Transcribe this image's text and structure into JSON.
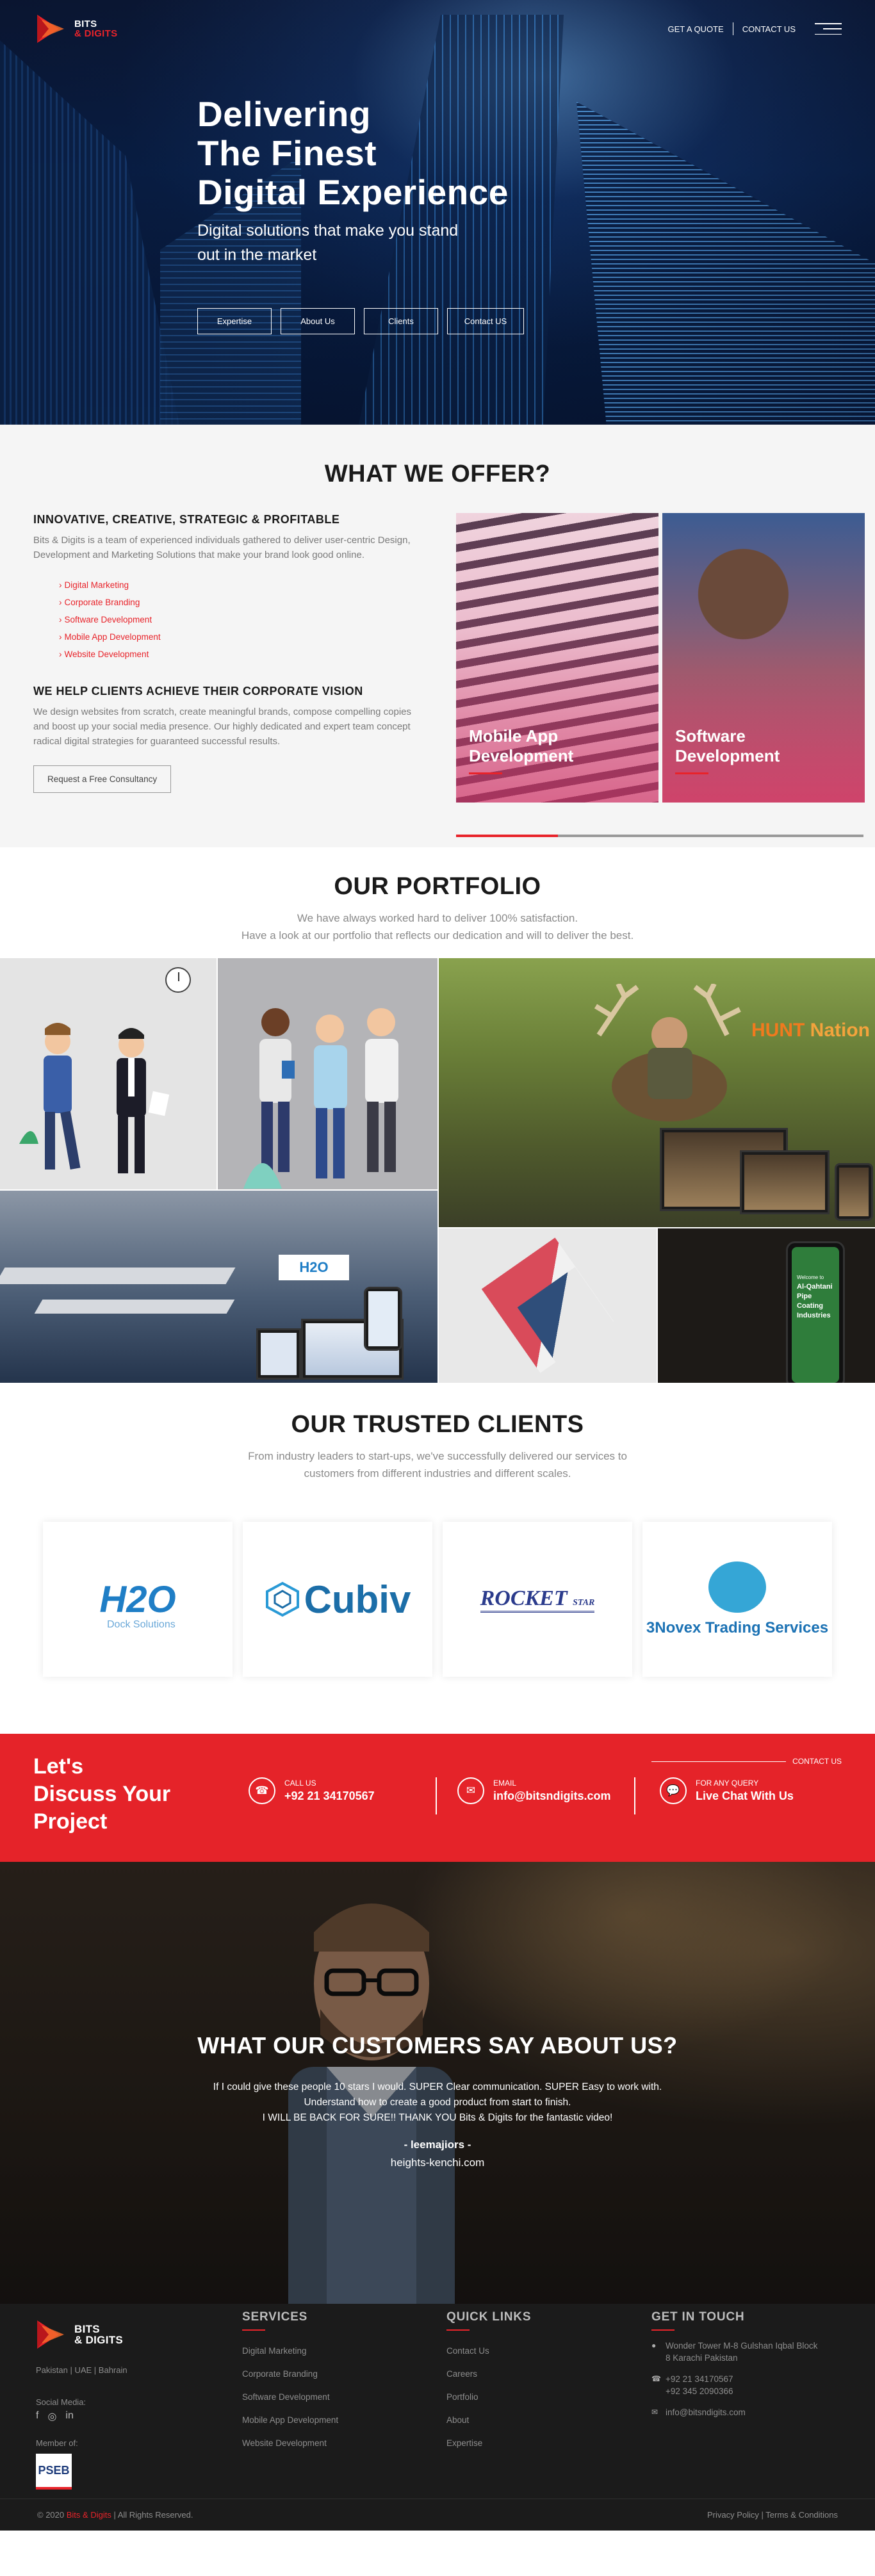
{
  "brand": {
    "name_line1": "BITS",
    "name_line2": "& DIGITS",
    "accent": "#e8232a"
  },
  "nav": {
    "quote": "GET A QUOTE",
    "contact": "CONTACT US",
    "menu_icon": "hamburger-icon"
  },
  "hero": {
    "title_l1": "Delivering",
    "title_l2": "The Finest",
    "title_l3": "Digital Experience",
    "subtitle": "Digital solutions that make you stand out in the market",
    "buttons": [
      "Expertise",
      "About Us",
      "Clients",
      "Contact US"
    ]
  },
  "offer": {
    "title": "WHAT WE OFFER?",
    "h1": "INNOVATIVE, CREATIVE, STRATEGIC & PROFITABLE",
    "p1": "Bits & Digits is a team of experienced individuals gathered to deliver user-centric Design, Development and Marketing Solutions that make your brand look good online.",
    "list": [
      "Digital Marketing",
      "Corporate Branding",
      "Software Development",
      "Mobile App Development",
      "Website Development"
    ],
    "h2": "WE HELP CLIENTS ACHIEVE THEIR CORPORATE VISION",
    "p2": "We design websites from scratch, create meaningful brands, compose compelling copies and boost up your social media presence. Our highly dedicated and expert team concept radical digital strategies for guaranteed successful results.",
    "cta": "Request a Free Consultancy",
    "cards": [
      {
        "l1": "Mobile App",
        "l2": "Development"
      },
      {
        "l1": "Software",
        "l2": "Development"
      }
    ],
    "slider_progress": 0.25
  },
  "portfolio": {
    "title": "OUR PORTFOLIO",
    "line1": "We have always worked hard to deliver 100% satisfaction.",
    "line2": "Have a look at our portfolio that reflects our dedication and will to deliver the best.",
    "hunt": "HUNT",
    "nation": "Nation",
    "h2o": "H2O",
    "phone_text": "Al-Qahtani Pipe Coating Industries",
    "phone_welcome": "Welcome to"
  },
  "clients": {
    "title": "OUR TRUSTED CLIENTS",
    "line1": "From industry leaders to start-ups, we've successfully delivered our services to",
    "line2": "customers from different industries and different scales.",
    "logos": [
      {
        "name": "H2O",
        "sub": "Dock Solutions"
      },
      {
        "name": "Cubiv"
      },
      {
        "name": "ROCKET",
        "sub": "STAR"
      },
      {
        "name": "3Novex Trading Services"
      }
    ]
  },
  "contact_band": {
    "l1": "Let's",
    "l2": "Discuss Your",
    "l3": "Project",
    "contact_us": "CONTACT US",
    "call_label": "CALL US",
    "call_value": "+92 21 34170567",
    "email_label": "EMAIL",
    "email_value": "info@bitsndigits.com",
    "query_label": "FOR ANY QUERY",
    "query_value": "Live Chat With Us"
  },
  "testimonial": {
    "title": "WHAT OUR CUSTOMERS SAY ABOUT US?",
    "q1": "If I could give these people 10 stars I would. SUPER Clear communication. SUPER Easy to work with.",
    "q2": "Understand how to create a good product from start to finish.",
    "q3": "I WILL BE BACK FOR SURE!! THANK YOU Bits & Digits for the fantastic video!",
    "author": "- leemajiors -",
    "site": "heights-kenchi.com"
  },
  "footer": {
    "countries": "Pakistan  |  UAE  |  Bahrain",
    "social_label": "Social Media:",
    "member_label": "Member of:",
    "pseb": "PSEB",
    "services_title": "SERVICES",
    "services": [
      "Digital Marketing",
      "Corporate Branding",
      "Software Development",
      "Mobile App Development",
      "Website Development"
    ],
    "links_title": "QUICK LINKS",
    "links": [
      "Contact Us",
      "Careers",
      "Portfolio",
      "About",
      "Expertise"
    ],
    "touch_title": "GET IN TOUCH",
    "addr1": "Wonder Tower M-8 Gulshan Iqbal Block",
    "addr2": "8 Karachi Pakistan",
    "phone1": "+92 21 34170567",
    "phone2": "+92 345 2090366",
    "email": "info@bitsndigits.com",
    "copy_pre": "© 2020",
    "copy_brand": "Bits & Digits",
    "copy_post": "| All Rights Reserved.",
    "legal": "Privacy Policy  |  Terms & Conditions"
  }
}
